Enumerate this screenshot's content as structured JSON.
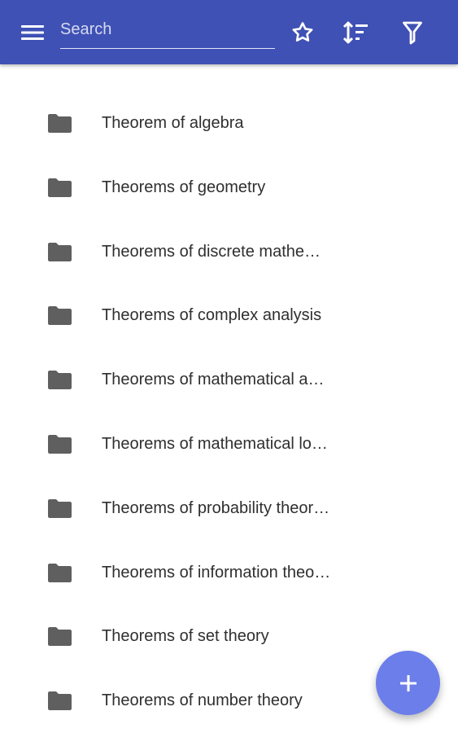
{
  "appbar": {
    "search": {
      "placeholder": "Search",
      "value": ""
    },
    "icons": {
      "menu": "menu-icon",
      "star": "star-icon",
      "sort": "sort-icon",
      "filter": "filter-icon"
    },
    "color": "#3f51b5"
  },
  "list": {
    "items": [
      {
        "label": "Theorem of algebra",
        "icon": "folder-icon"
      },
      {
        "label": "Theorems of geometry",
        "icon": "folder-icon"
      },
      {
        "label": "Theorems of discrete mathe…",
        "icon": "folder-icon"
      },
      {
        "label": "Theorems of complex analysis",
        "icon": "folder-icon"
      },
      {
        "label": "Theorems of mathematical a…",
        "icon": "folder-icon"
      },
      {
        "label": "Theorems of mathematical lo…",
        "icon": "folder-icon"
      },
      {
        "label": "Theorems of probability theor…",
        "icon": "folder-icon"
      },
      {
        "label": "Theorems of information theo…",
        "icon": "folder-icon"
      },
      {
        "label": "Theorems of set theory",
        "icon": "folder-icon"
      },
      {
        "label": "Theorems of number theory",
        "icon": "folder-icon"
      }
    ]
  },
  "fab": {
    "icon": "plus-icon",
    "color": "#6c7eea"
  }
}
